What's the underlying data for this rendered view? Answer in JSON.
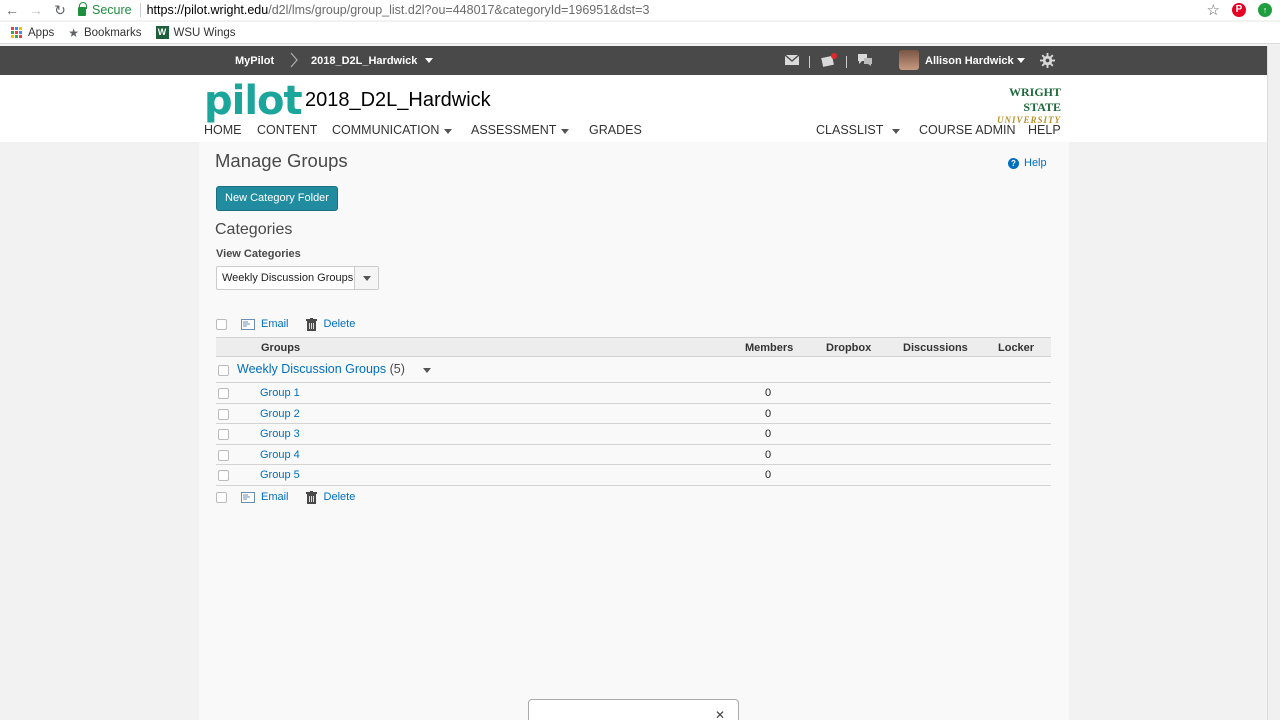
{
  "browser": {
    "secure_label": "Secure",
    "url_host": "https://pilot.wright.edu",
    "url_path": "/d2l/lms/group/group_list.d2l?ou=448017&categoryId=196951&dst=3",
    "bookmarks": [
      {
        "label": "Apps",
        "icon": "apps-grid-icon"
      },
      {
        "label": "Bookmarks",
        "icon": "star-icon"
      },
      {
        "label": "WSU Wings",
        "icon": "wsu-w-icon"
      }
    ]
  },
  "minibar": {
    "home": "MyPilot",
    "course": "2018_D2L_Hardwick",
    "user": "Allison Hardwick"
  },
  "header": {
    "logo": "pilot",
    "course_title": "2018_D2L_Hardwick",
    "brand_line1": "WRIGHT STATE",
    "brand_line2": "UNIVERSITY",
    "nav": {
      "home": "HOME",
      "content": "CONTENT",
      "communication": "COMMUNICATION",
      "assessment": "ASSESSMENT",
      "grades": "GRADES",
      "classlist": "CLASSLIST",
      "course_admin": "COURSE ADMIN",
      "help": "HELP"
    }
  },
  "main": {
    "title": "Manage Groups",
    "help": "Help",
    "new_category_button": "New Category Folder",
    "categories_heading": "Categories",
    "view_categories_label": "View Categories",
    "view_categories_value": "Weekly Discussion Groups",
    "actions": {
      "email": "Email",
      "delete": "Delete"
    },
    "columns": {
      "groups": "Groups",
      "members": "Members",
      "dropbox": "Dropbox",
      "discussions": "Discussions",
      "locker": "Locker"
    },
    "category": {
      "name": "Weekly Discussion Groups",
      "count": "(5)"
    },
    "groups": [
      {
        "name": "Group 1",
        "members": "0"
      },
      {
        "name": "Group 2",
        "members": "0"
      },
      {
        "name": "Group 3",
        "members": "0"
      },
      {
        "name": "Group 4",
        "members": "0"
      },
      {
        "name": "Group 5",
        "members": "0"
      }
    ]
  },
  "colors": {
    "minibar": "#494949",
    "brand_teal": "#1ba59b",
    "button": "#218ca0",
    "link": "#006fbf"
  }
}
